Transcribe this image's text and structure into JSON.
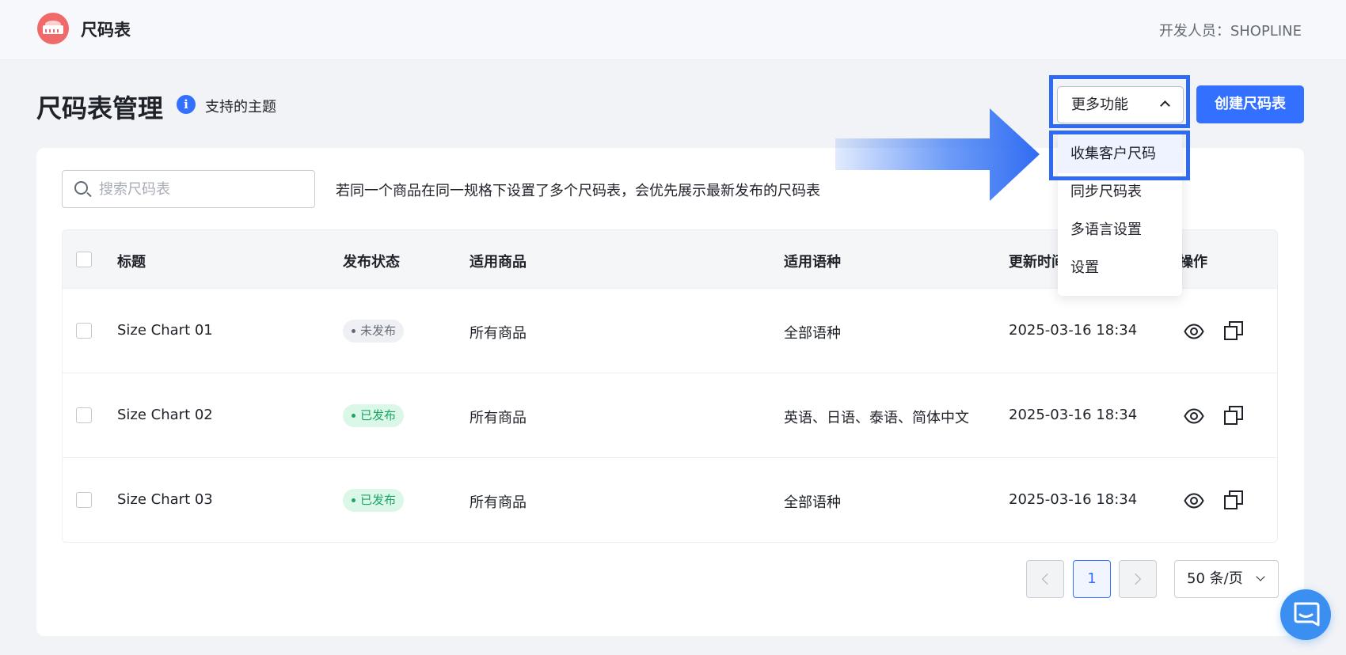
{
  "header": {
    "app_name": "尺码表",
    "developer": "开发人员：SHOPLINE"
  },
  "page": {
    "title": "尺码表管理",
    "supported_themes": "支持的主题"
  },
  "toolbar": {
    "more_label": "更多功能",
    "create_label": "创建尺码表"
  },
  "dropdown": {
    "items": [
      {
        "label": "收集客户尺码"
      },
      {
        "label": "同步尺码表"
      },
      {
        "label": "多语言设置"
      },
      {
        "label": "设置"
      }
    ]
  },
  "search": {
    "placeholder": "搜索尺码表",
    "value": ""
  },
  "hint": "若同一个商品在同一规格下设置了多个尺码表，会优先展示最新发布的尺码表",
  "table": {
    "columns": {
      "title": "标题",
      "status": "发布状态",
      "products": "适用商品",
      "languages": "适用语种",
      "updated": "更新时间",
      "actions": "操作"
    },
    "rows": [
      {
        "title": "Size Chart 01",
        "status": "未发布",
        "products": "所有商品",
        "languages": "全部语种",
        "updated": "2025-03-16 18:34"
      },
      {
        "title": "Size Chart 02",
        "status": "已发布",
        "products": "所有商品",
        "languages": "英语、日语、泰语、简体中文",
        "updated": "2025-03-16 18:34"
      },
      {
        "title": "Size Chart 03",
        "status": "已发布",
        "products": "所有商品",
        "languages": "全部语种",
        "updated": "2025-03-16 18:34"
      }
    ]
  },
  "pagination": {
    "current_page": "1",
    "page_size": "50 条/页"
  },
  "colors": {
    "primary": "#3370ff",
    "highlight": "#2f6bf2",
    "logo": "#f06a6a",
    "published": "#1fa464"
  },
  "icons": {
    "logo": "measuring-tape-icon",
    "info": "info-icon",
    "search": "search-icon",
    "view": "eye-icon",
    "copy": "copy-icon",
    "chat": "chat-icon"
  }
}
